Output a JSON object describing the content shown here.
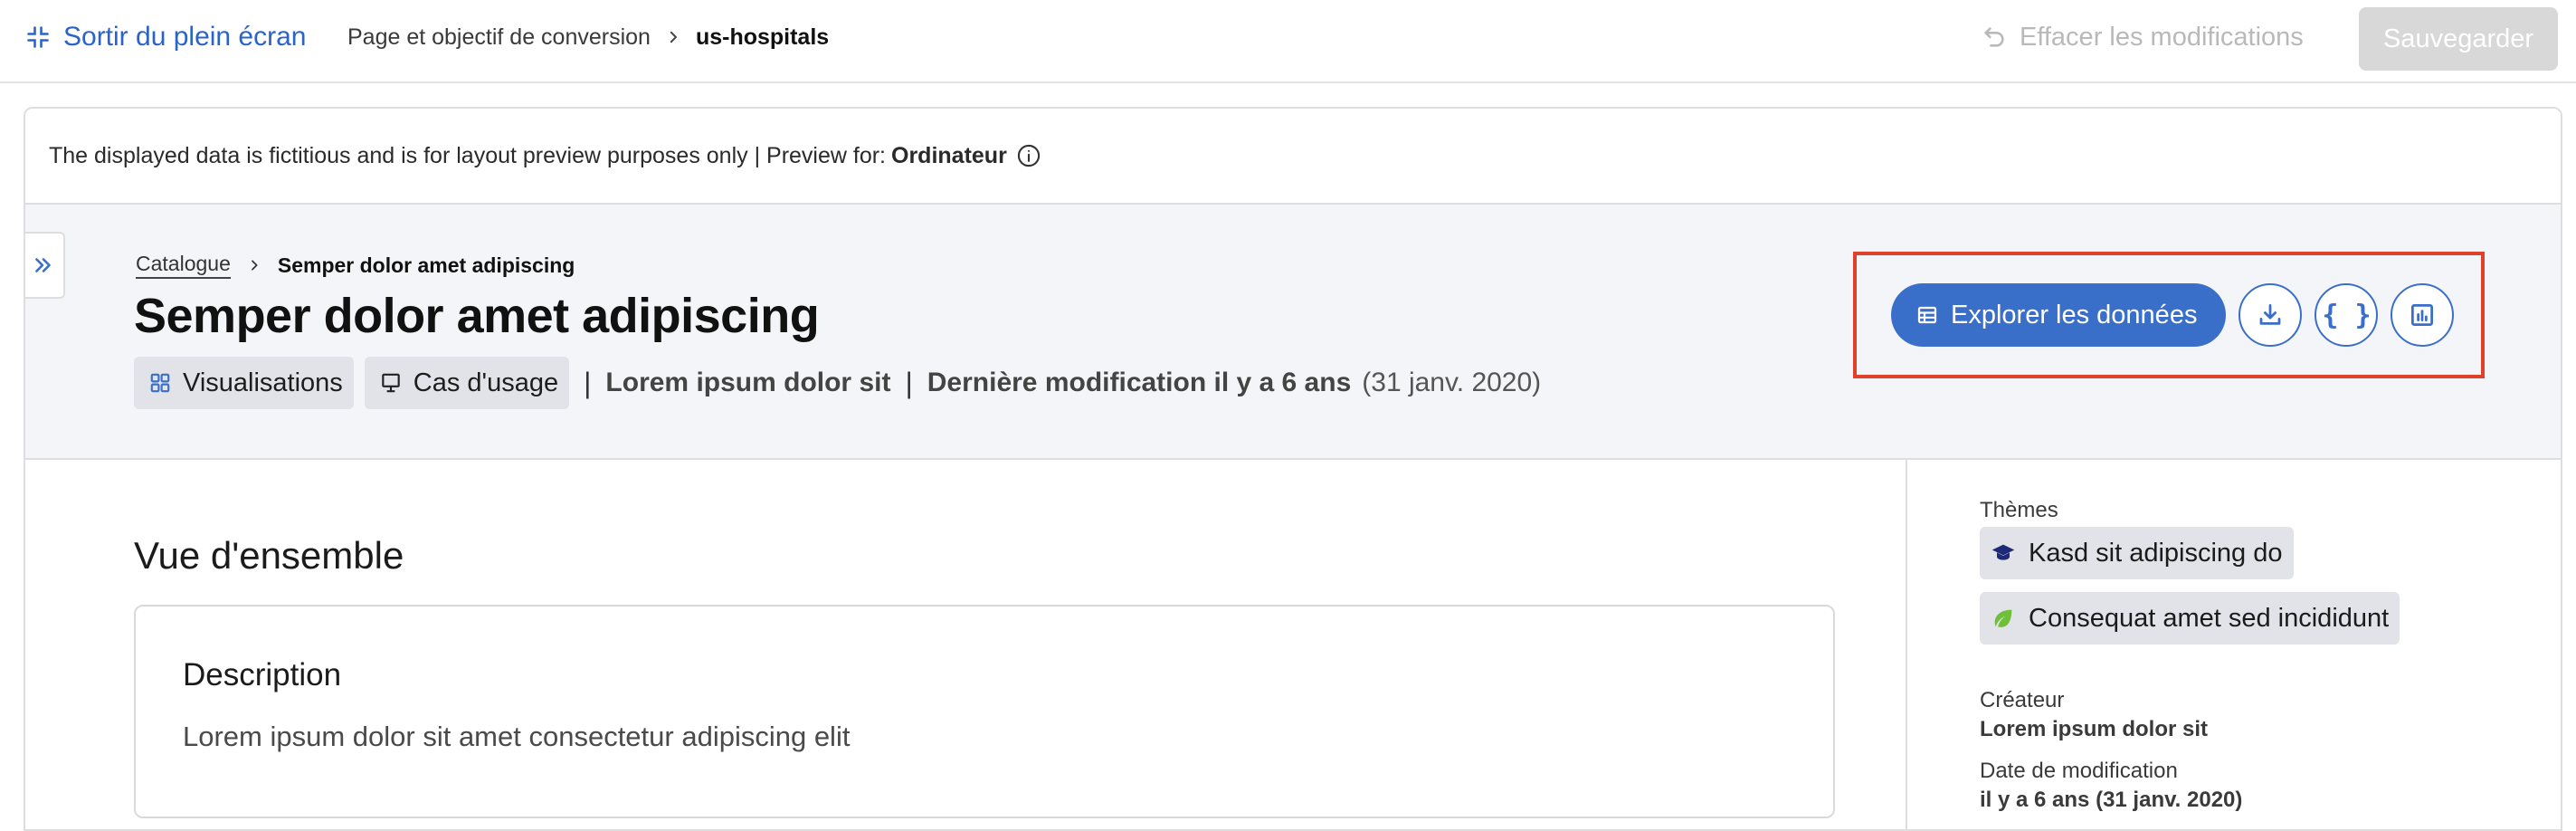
{
  "topbar": {
    "exit_fullscreen": "Sortir du plein écran",
    "breadcrumb_parent": "Page et objectif de conversion",
    "breadcrumb_current": "us-hospitals",
    "undo_label": "Effacer les modifications",
    "save_label": "Sauvegarder"
  },
  "notice": {
    "text": "The displayed data is fictitious and is for layout preview purposes only | Preview for:",
    "device": "Ordinateur"
  },
  "hero": {
    "breadcrumb_link": "Catalogue",
    "breadcrumb_current": "Semper dolor amet adipiscing",
    "title": "Semper dolor amet adipiscing",
    "chip_visualisations": "Visualisations",
    "chip_usecases": "Cas d'usage",
    "sep": "|",
    "publisher": "Lorem ipsum dolor sit",
    "modified": "Dernière modification il y a 6 ans",
    "modified_date": "(31 janv. 2020)"
  },
  "actions": {
    "explore_label": "Explorer les données",
    "api_label": "{ }"
  },
  "overview": {
    "title": "Vue d'ensemble",
    "desc_heading": "Description",
    "desc_text": "Lorem ipsum dolor sit amet consectetur adipiscing elit"
  },
  "sidebar": {
    "themes_label": "Thèmes",
    "themes": [
      "Kasd sit adipiscing do",
      "Consequat amet sed incididunt"
    ],
    "creator_label": "Créateur",
    "creator_value": "Lorem ipsum dolor sit",
    "modified_label": "Date de modification",
    "modified_value": "il y a 6 ans (31 janv. 2020)"
  },
  "colors": {
    "accent": "#3a6fc9",
    "highlight": "#e0412b",
    "link": "#2a63c9"
  }
}
